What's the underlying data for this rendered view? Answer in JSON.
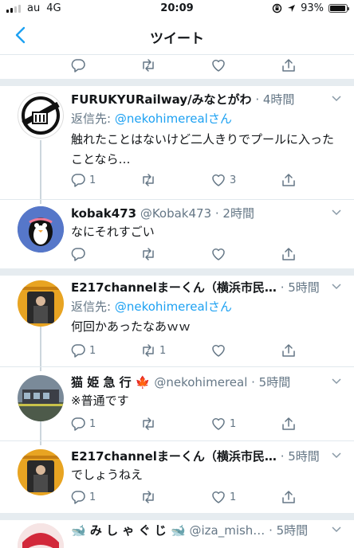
{
  "status": {
    "carrier": "au",
    "network": "4G",
    "time": "20:09",
    "battery": "93%"
  },
  "nav": {
    "title": "ツイート"
  },
  "tweets": [
    {
      "name": "FURUKYURailway/みなとがわ",
      "meta": "· 4時間",
      "reply_prefix": "返信先: ",
      "reply_handle": "@nekohimerealさん",
      "text": "触れたことはないけど二人きりでプールに入ったことなら…",
      "replies": "1",
      "retweets": "",
      "likes": "3"
    },
    {
      "name": "kobak473",
      "meta": "@Kobak473 · 2時間",
      "text": "なにそれすごい",
      "replies": "",
      "retweets": "",
      "likes": ""
    },
    {
      "name": "E217channelまーくん（横浜市民…",
      "meta": "· 5時間",
      "reply_prefix": "返信先: ",
      "reply_handle": "@nekohimerealさん",
      "text": "何回かあったなあｗｗ",
      "replies": "1",
      "retweets": "1",
      "likes": ""
    },
    {
      "name": "猫 姫 急 行 🍁",
      "meta": "@nekohimereal · 5時間",
      "text": "※普通です",
      "replies": "1",
      "retweets": "",
      "likes": "1"
    },
    {
      "name": "E217channelまーくん（横浜市民…",
      "meta": "· 5時間",
      "text": "でしょうねえ",
      "replies": "1",
      "retweets": "",
      "likes": "1"
    },
    {
      "name": "🐋 み し ゃ ぐ じ 🐋",
      "meta": "@iza_mish… · 5時間"
    }
  ]
}
